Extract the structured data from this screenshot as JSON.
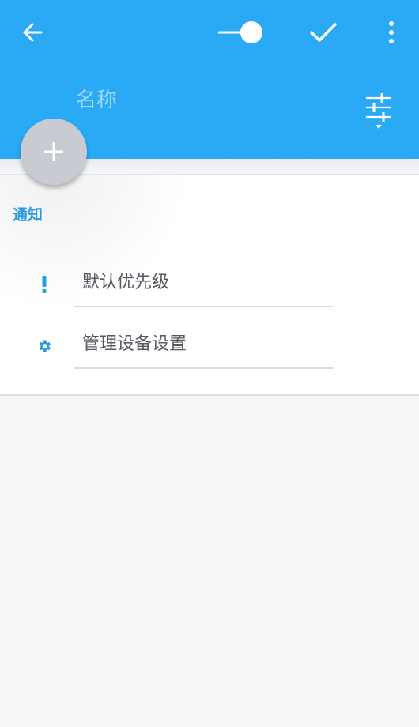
{
  "toolbar": {
    "back_icon": "arrow-left-icon",
    "toggle_icon": "toggle-switch-icon",
    "confirm_icon": "check-icon",
    "menu_icon": "more-vert-icon"
  },
  "header": {
    "name_placeholder": "名称",
    "name_value": "",
    "filter_icon": "tune-icon"
  },
  "fab": {
    "icon": "plus-icon"
  },
  "notification": {
    "section_title": "通知",
    "items": [
      {
        "label": "默认优先级",
        "icon": "exclamation-icon"
      },
      {
        "label": "管理设备设置",
        "icon": "gear-icon"
      }
    ]
  },
  "colors": {
    "primary": "#2aa9f5",
    "accent": "#2a9be0",
    "background": "#f5f6f8",
    "fab": "#c8ccd2"
  }
}
